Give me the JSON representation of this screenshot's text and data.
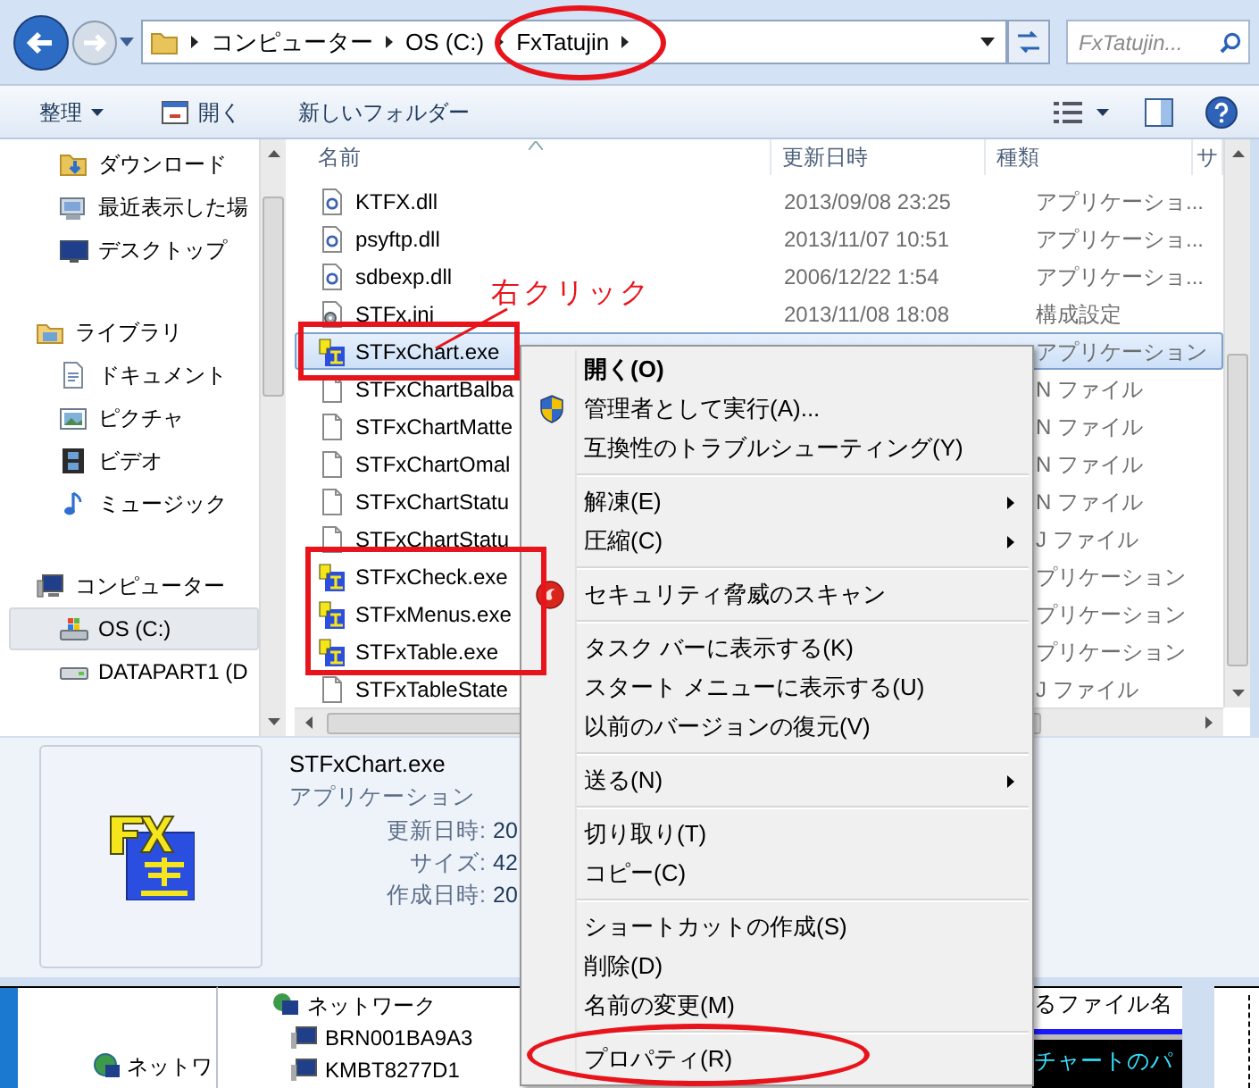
{
  "address_bar": {
    "breadcrumbs": [
      "コンピューター",
      "OS (C:)",
      "FxTatujin"
    ],
    "search_placeholder": "FxTatujin..."
  },
  "toolbar": {
    "items": [
      {
        "label": "整理",
        "kind": "dropdown"
      },
      {
        "label": "開く",
        "kind": "open"
      },
      {
        "label": "新しいフォルダー",
        "kind": "plain"
      }
    ]
  },
  "sidebar": {
    "groups": [
      {
        "items": [
          {
            "label": "ダウンロード",
            "kind": "downloads",
            "selected": false
          },
          {
            "label": "最近表示した場",
            "kind": "recent",
            "selected": false
          },
          {
            "label": "デスクトップ",
            "kind": "desktop",
            "selected": false
          }
        ]
      },
      {
        "items": [
          {
            "label": "ライブラリ",
            "kind": "library",
            "selected": false
          },
          {
            "label": "ドキュメント",
            "kind": "documents",
            "selected": false
          },
          {
            "label": "ピクチャ",
            "kind": "pictures",
            "selected": false
          },
          {
            "label": "ビデオ",
            "kind": "videos",
            "selected": false
          },
          {
            "label": "ミュージック",
            "kind": "music",
            "selected": false
          }
        ]
      },
      {
        "items": [
          {
            "label": "コンピューター",
            "kind": "computer",
            "selected": false
          },
          {
            "label": "OS (C:)",
            "kind": "system-drive",
            "selected": true
          },
          {
            "label": "DATAPART1 (D",
            "kind": "drive",
            "selected": false
          }
        ]
      }
    ]
  },
  "file_list": {
    "columns": [
      "名前",
      "更新日時",
      "種類",
      "サ"
    ],
    "rows": [
      {
        "name": "KTFX.dll",
        "modified": "2013/09/08 23:25",
        "type": "アプリケーショ...",
        "kind": "dll",
        "selected": false
      },
      {
        "name": "psyftp.dll",
        "modified": "2013/11/07 10:51",
        "type": "アプリケーショ...",
        "kind": "dll",
        "selected": false
      },
      {
        "name": "sdbexp.dll",
        "modified": "2006/12/22 1:54",
        "type": "アプリケーショ...",
        "kind": "dll",
        "selected": false
      },
      {
        "name": "STFx.ini",
        "modified": "2013/11/08 18:08",
        "type": "構成設定",
        "kind": "ini",
        "selected": false
      },
      {
        "name": "STFxChart.exe",
        "type": "アプリケーション",
        "kind": "exe",
        "selected": true
      },
      {
        "name": "STFxChartBalba",
        "type": "N ファイル",
        "kind": "file",
        "selected": false
      },
      {
        "name": "STFxChartMatte",
        "type": "N ファイル",
        "kind": "file",
        "selected": false
      },
      {
        "name": "STFxChartOmal",
        "type": "N ファイル",
        "kind": "file",
        "selected": false
      },
      {
        "name": "STFxChartStatu",
        "type": "N ファイル",
        "kind": "file",
        "selected": false
      },
      {
        "name": "STFxChartStatu",
        "type": "J ファイル",
        "kind": "file",
        "selected": false
      },
      {
        "name": "STFxCheck.exe",
        "type": "プリケーション",
        "kind": "exe",
        "selected": false
      },
      {
        "name": "STFxMenus.exe",
        "type": "プリケーション",
        "kind": "exe",
        "selected": false
      },
      {
        "name": "STFxTable.exe",
        "type": "プリケーション",
        "kind": "exe",
        "selected": false
      },
      {
        "name": "STFxTableState",
        "type": "J ファイル",
        "kind": "file",
        "selected": false
      }
    ]
  },
  "details_pane": {
    "file_name": "STFxChart.exe",
    "file_type": "アプリケーション",
    "fields": [
      {
        "label": "更新日時:",
        "value": "20"
      },
      {
        "label": "サイズ:",
        "value": "42"
      },
      {
        "label": "作成日時:",
        "value": "20"
      }
    ]
  },
  "context_menu": {
    "groups": [
      [
        {
          "label": "開く(O)",
          "default": true,
          "kind": "plain",
          "submenu": false
        },
        {
          "label": "管理者として実行(A)...",
          "default": false,
          "kind": "shield",
          "submenu": false
        },
        {
          "label": "互換性のトラブルシューティング(Y)",
          "default": false,
          "kind": "plain",
          "submenu": false
        }
      ],
      [
        {
          "label": "解凍(E)",
          "default": false,
          "kind": "plain",
          "submenu": true
        },
        {
          "label": "圧縮(C)",
          "default": false,
          "kind": "plain",
          "submenu": true
        }
      ],
      [
        {
          "label": "セキュリティ脅威のスキャン",
          "default": false,
          "kind": "scan",
          "submenu": false
        }
      ],
      [
        {
          "label": "タスク バーに表示する(K)",
          "default": false,
          "kind": "plain",
          "submenu": false
        },
        {
          "label": "スタート メニューに表示する(U)",
          "default": false,
          "kind": "plain",
          "submenu": false
        },
        {
          "label": "以前のバージョンの復元(V)",
          "default": false,
          "kind": "plain",
          "submenu": false
        }
      ],
      [
        {
          "label": "送る(N)",
          "default": false,
          "kind": "plain",
          "submenu": true
        }
      ],
      [
        {
          "label": "切り取り(T)",
          "default": false,
          "kind": "plain",
          "submenu": false
        },
        {
          "label": "コピー(C)",
          "default": false,
          "kind": "plain",
          "submenu": false
        }
      ],
      [
        {
          "label": "ショートカットの作成(S)",
          "default": false,
          "kind": "plain",
          "submenu": false
        },
        {
          "label": "削除(D)",
          "default": false,
          "kind": "plain",
          "submenu": false
        },
        {
          "label": "名前の変更(M)",
          "default": false,
          "kind": "plain",
          "submenu": false
        }
      ],
      [
        {
          "label": "プロパティ(R)",
          "default": false,
          "kind": "plain",
          "submenu": false
        }
      ]
    ]
  },
  "annotation": {
    "callout": "右クリック"
  },
  "background_window": {
    "tree_items": [
      "ネットワ"
    ],
    "list_items": [
      "ネットワーク",
      "BRN001BA9A3",
      "KMBT8277D1"
    ],
    "doc_text": "るファイル名",
    "highlight_text": "チャートのパ"
  }
}
